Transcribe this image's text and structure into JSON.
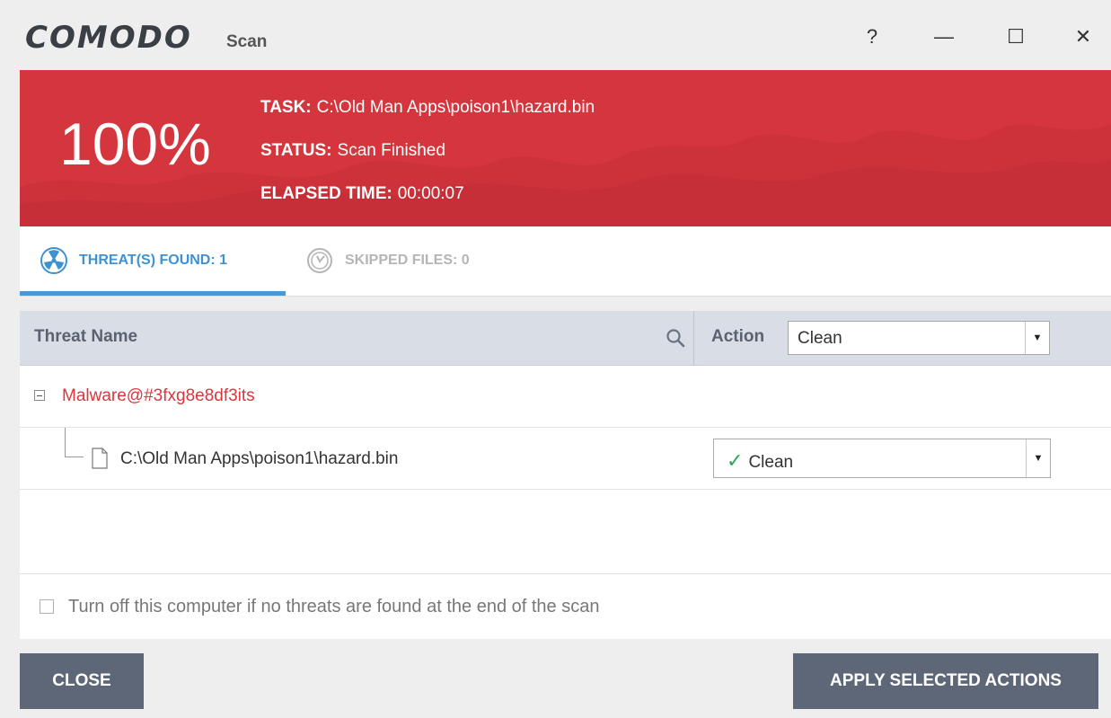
{
  "window": {
    "brand": "COMODO",
    "subtitle": "Scan",
    "help_label": "?",
    "minimize_label": "—",
    "maximize_label": "☐",
    "close_label": "✕"
  },
  "banner": {
    "percent": "100%",
    "task_label": "TASK:",
    "task_value": "C:\\Old Man Apps\\poison1\\hazard.bin",
    "status_label": "STATUS:",
    "status_value": "Scan Finished",
    "elapsed_label": "ELAPSED TIME:",
    "elapsed_value": "00:00:07",
    "color": "#d5363e"
  },
  "tabs": [
    {
      "label": "THREAT(S) FOUND: 1",
      "icon": "radiation-icon",
      "active": true
    },
    {
      "label": "SKIPPED FILES: 0",
      "icon": "skipped-clock-icon",
      "active": false
    }
  ],
  "table": {
    "col_threat_name": "Threat Name",
    "col_action": "Action",
    "header_action_value": "Clean",
    "groups": [
      {
        "name": "Malware@#3fxg8e8df3its",
        "files": [
          {
            "path": "C:\\Old Man Apps\\poison1\\hazard.bin",
            "action": "Clean"
          }
        ]
      }
    ]
  },
  "shutdown_option": {
    "label": "Turn off this computer if no threats are found at the end of the scan",
    "checked": false
  },
  "footer": {
    "close_label": "CLOSE",
    "apply_label": "APPLY SELECTED ACTIONS"
  }
}
